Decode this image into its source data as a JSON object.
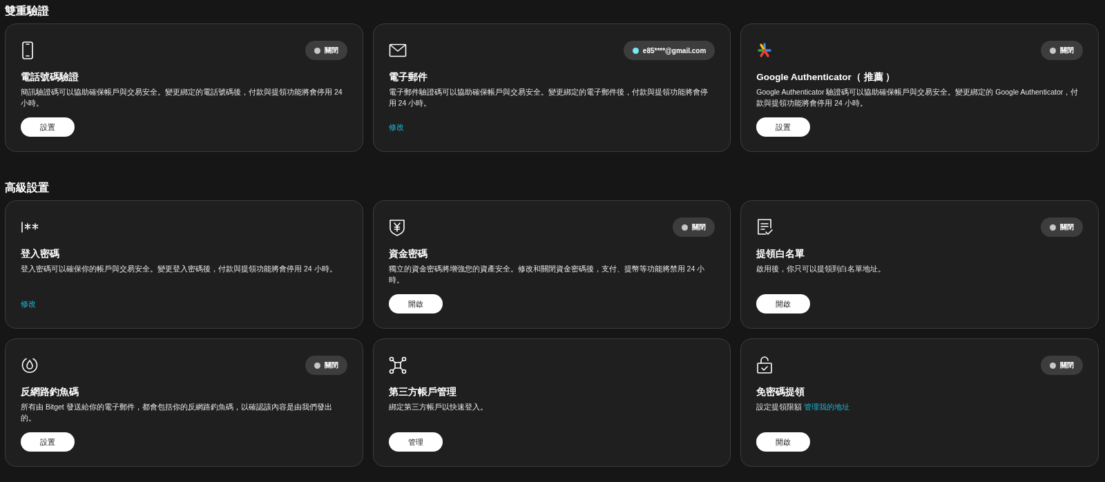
{
  "sections": [
    {
      "title": "雙重驗證",
      "cards": [
        {
          "title": "電話號碼驗證",
          "description": "簡訊驗證碼可以協助確保帳戶與交易安全。變更綁定的電話號碼後，付款與提領功能將會停用 24 小時。",
          "status": {
            "label": "關閉",
            "on": false
          },
          "action": {
            "kind": "button",
            "label": "設置"
          }
        },
        {
          "title": "電子郵件",
          "description": "電子郵件驗證碼可以協助確保帳戶與交易安全。變更綁定的電子郵件後，付款與提領功能將會停用 24 小時。",
          "status": {
            "label": "e85****@gmail.com",
            "on": true
          },
          "action": {
            "kind": "link",
            "label": "修改"
          }
        },
        {
          "title": "Google Authenticator（ 推薦 ）",
          "description": "Google Authenticator 驗證碼可以協助確保帳戶與交易安全。變更綁定的 Google Authenticator，付款與提領功能將會停用 24 小時。",
          "status": {
            "label": "關閉",
            "on": false
          },
          "action": {
            "kind": "button",
            "label": "設置"
          }
        }
      ]
    },
    {
      "title": "高級設置",
      "cards": [
        {
          "title": "登入密碼",
          "description": "登入密碼可以確保你的帳戶與交易安全。變更登入密碼後，付款與提領功能將會停用 24 小時。",
          "action": {
            "kind": "link",
            "label": "修改"
          }
        },
        {
          "title": "資金密碼",
          "description": "獨立的資金密碼將增強您的資產安全。修改和關閉資金密碼後，支付、提幣等功能將禁用 24 小時。",
          "status": {
            "label": "關閉",
            "on": false
          },
          "action": {
            "kind": "button",
            "label": "開啟"
          }
        },
        {
          "title": "提領白名單",
          "description": "啟用後，你只可以提領到白名單地址。",
          "status": {
            "label": "關閉",
            "on": false
          },
          "action": {
            "kind": "button",
            "label": "開啟"
          }
        },
        {
          "title": "反網路釣魚碼",
          "description": "所有由 Bitget 發送給你的電子郵件，都會包括你的反網路釣魚碼，以確認該內容是由我們發出的。",
          "status": {
            "label": "關閉",
            "on": false
          },
          "action": {
            "kind": "button",
            "label": "設置"
          }
        },
        {
          "title": "第三方帳戶管理",
          "description": "綁定第三方帳戶以快速登入。",
          "action": {
            "kind": "button",
            "label": "管理"
          }
        },
        {
          "title": "免密碼提領",
          "description": "設定提領限額",
          "description_link": "管理我的地址",
          "status": {
            "label": "關閉",
            "on": false
          },
          "action": {
            "kind": "button",
            "label": "開啟"
          }
        }
      ]
    }
  ]
}
